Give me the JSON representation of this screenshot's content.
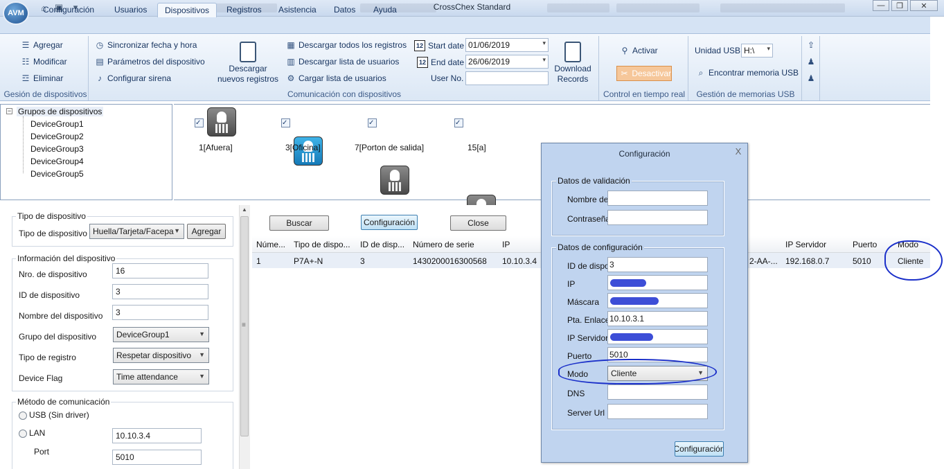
{
  "window": {
    "title": "CrossChex Standard",
    "app_logo_text": "AVM",
    "minimize": "—",
    "maximize": "❐",
    "close": "✕"
  },
  "ribbon_tabs": [
    "Configuración",
    "Usuarios",
    "Dispositivos",
    "Registros",
    "Asistencia",
    "Datos",
    "Ayuda"
  ],
  "active_tab": "Dispositivos",
  "ribbon": {
    "device_mgmt": {
      "label": "Gesión de dispositivos",
      "add": "Agregar",
      "modify": "Modificar",
      "delete": "Eliminar"
    },
    "communication": {
      "label": "Comunicación con dispositivos",
      "sync_time": "Sincronizar fecha y hora",
      "device_params": "Parámetros del dispositivo",
      "siren": "Configurar sirena",
      "download_new": "Descargar nuevos registros",
      "download_all": "Descargar todos los registros",
      "download_users": "Descargar lista de usuarios",
      "upload_users": "Cargar lista de usuarios",
      "start_date_label": "Start date",
      "start_date": "01/06/2019",
      "end_date_label": "End date",
      "end_date": "26/06/2019",
      "user_no_label": "User No.",
      "user_no": "",
      "download_records": "Download Records"
    },
    "realtime": {
      "label": "Control en tiempo real",
      "activate": "Activar",
      "deactivate": "Desactivar"
    },
    "usb": {
      "label": "Gestión de memorias USB",
      "drive_label": "Unidad USB",
      "drive": "H:\\",
      "find": "Encontrar memoria USB"
    }
  },
  "tree": {
    "root": "Grupos de dispositivos",
    "groups": [
      "DeviceGroup1",
      "DeviceGroup2",
      "DeviceGroup3",
      "DeviceGroup4",
      "DeviceGroup5"
    ]
  },
  "devices": [
    {
      "label": "1[Afuera]",
      "checked": "✓",
      "online": false
    },
    {
      "label": "3[Oficina]",
      "checked": "✓",
      "online": true
    },
    {
      "label": "7[Porton de salida]",
      "checked": "✓",
      "online": false
    },
    {
      "label": "15[a]",
      "checked": "✓",
      "online": false
    }
  ],
  "left_form": {
    "device_type_legend": "Tipo de dispositivo",
    "device_type_label": "Tipo de dispositivo",
    "device_type_value": "Huella/Tarjeta/Facepa",
    "add_button": "Agregar",
    "info_legend": "Información del dispositivo",
    "fields": [
      {
        "label": "Nro. de dispositivo",
        "value": "16",
        "kind": "text"
      },
      {
        "label": "ID de dispositivo",
        "value": "3",
        "kind": "text"
      },
      {
        "label": "Nombre del dispositivo",
        "value": "3",
        "kind": "text"
      },
      {
        "label": "Grupo del dispositivo",
        "value": "DeviceGroup1",
        "kind": "select"
      },
      {
        "label": "Tipo de registro",
        "value": "Respetar dispositivo",
        "kind": "select"
      },
      {
        "label": "Device Flag",
        "value": "Time attendance",
        "kind": "select"
      }
    ],
    "comm_legend": "Método de comunicación",
    "usb_label": "USB (Sin driver)",
    "lan_label": "LAN",
    "lan_ip": "10.10.3.4",
    "port_label": "Port",
    "port": "5010"
  },
  "actions": {
    "search": "Buscar",
    "config": "Configuración",
    "close": "Close"
  },
  "table": {
    "columns": [
      "Núme...",
      "Tipo de dispo...",
      "ID de disp...",
      "Número de serie",
      "IP",
      "IP Servidor",
      "Puerto",
      "Modo"
    ],
    "row": {
      "num": "1",
      "type": "P7A+-N",
      "id": "3",
      "serial": "1430200016300568",
      "ip": "10.10.3.4",
      "mac_partial": "2-AA-...",
      "server_ip": "192.168.0.7",
      "port": "5010",
      "mode": "Cliente"
    }
  },
  "dialog": {
    "title": "Configuración",
    "close": "X",
    "validation_legend": "Datos de validación",
    "name_label": "Nombre de",
    "name_value": "",
    "password_label": "Contraseña",
    "password_value": "",
    "config_legend": "Datos de configuración",
    "device_id_label": "ID de dispo",
    "device_id": "3",
    "ip_label": "IP",
    "mask_label": "Máscara",
    "gateway_label": "Pta. Enlace",
    "gateway": "10.10.3.1",
    "server_ip_label": "IP Servidor",
    "port_label": "Puerto",
    "port": "5010",
    "mode_label": "Modo",
    "mode": "Cliente",
    "dns_label": "DNS",
    "dns": "",
    "server_url_label": "Server Url",
    "server_url": "",
    "submit": "Configuración"
  },
  "colors": {
    "ribbon_bg": "#dbe7f5",
    "dialog_bg": "#c0d4ef",
    "annotation_ink": "#1a2fc9",
    "deactivate_bg": "#f6c79a"
  }
}
